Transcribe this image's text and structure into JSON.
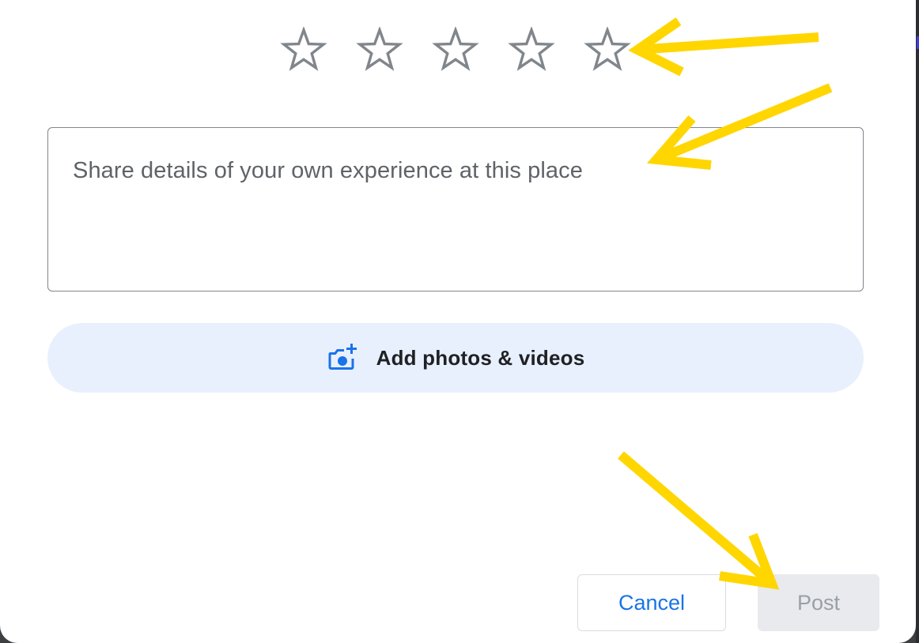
{
  "rating": {
    "stars": [
      {
        "name": "star-1-icon",
        "filled": false
      },
      {
        "name": "star-2-icon",
        "filled": false
      },
      {
        "name": "star-3-icon",
        "filled": false
      },
      {
        "name": "star-4-icon",
        "filled": false
      },
      {
        "name": "star-5-icon",
        "filled": false
      }
    ],
    "value": 0,
    "max": 5
  },
  "review": {
    "value": "",
    "placeholder": "Share details of your own experience at this place"
  },
  "media": {
    "label": "Add photos & videos",
    "icon": "add-photo-icon"
  },
  "actions": {
    "cancel_label": "Cancel",
    "post_label": "Post",
    "post_enabled": false
  },
  "annotations": {
    "arrow_icon": "arrow-icon",
    "arrow_color": "#FFD600"
  },
  "colors": {
    "accent": "#1a73e8",
    "media_bg": "#e8f0fe",
    "star_outline": "#80868b",
    "disabled_bg": "#e8eaed",
    "disabled_text": "#9aa0a6"
  }
}
